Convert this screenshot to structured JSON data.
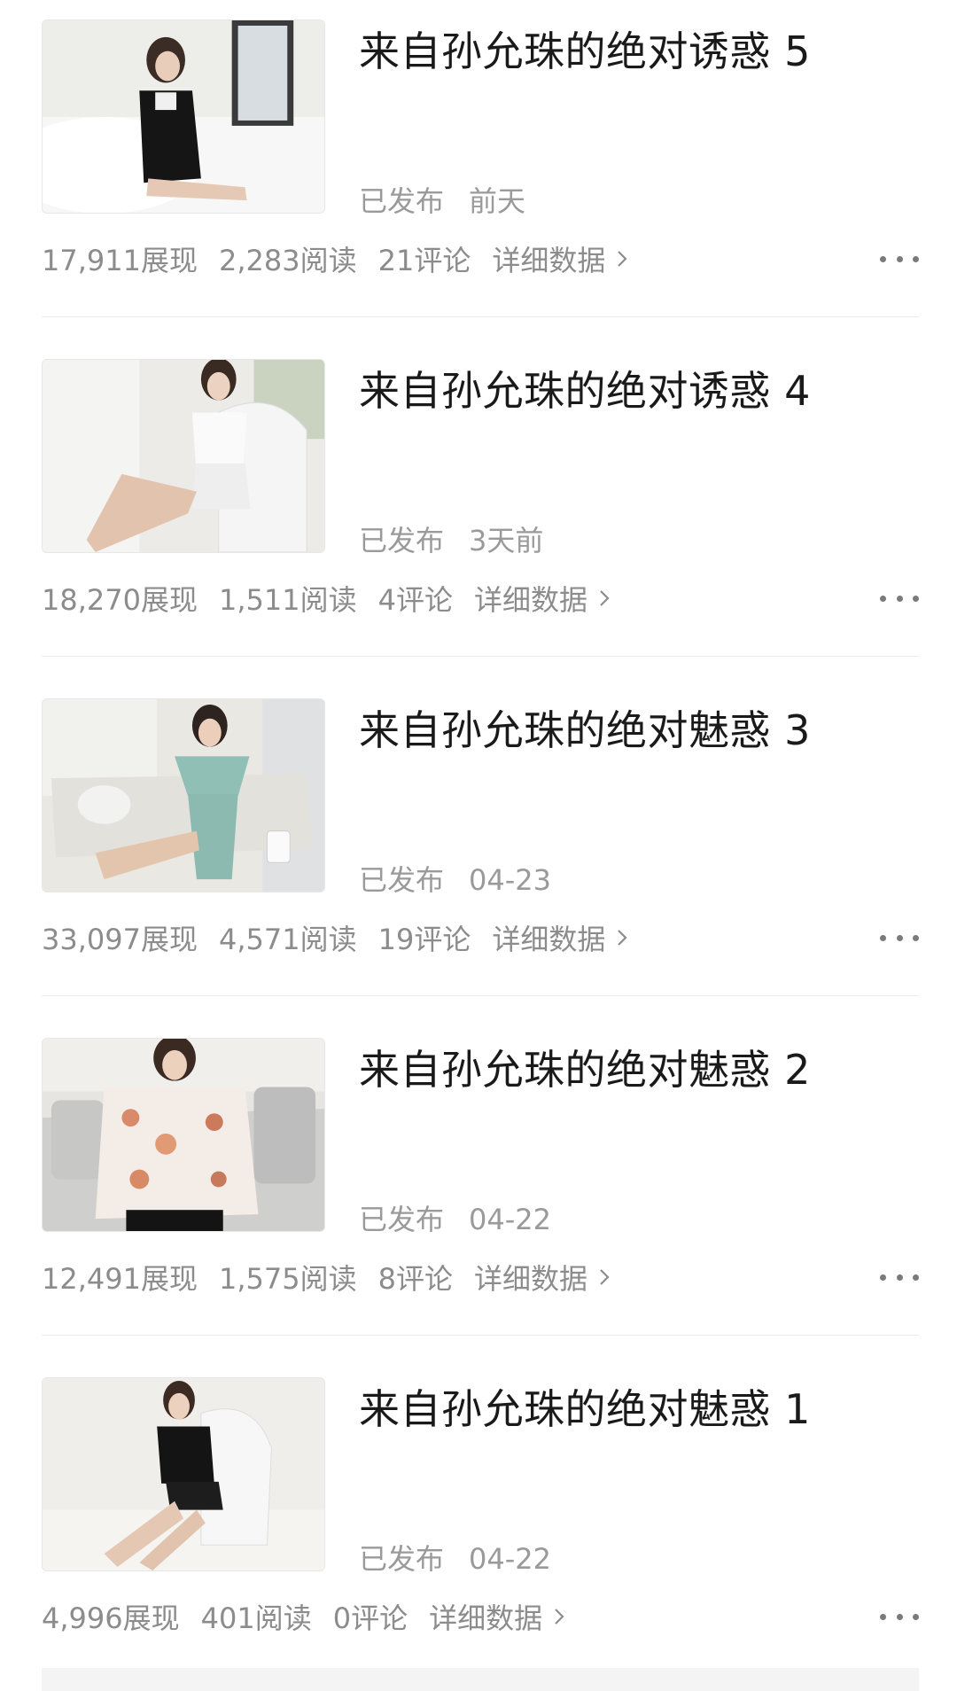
{
  "articles": [
    {
      "title": "来自孙允珠的绝对诱惑 5",
      "status": "已发布",
      "date": "前天",
      "impressions": "17,911展现",
      "reads": "2,283阅读",
      "comments": "21评论",
      "detail": "详细数据"
    },
    {
      "title": "来自孙允珠的绝对诱惑 4",
      "status": "已发布",
      "date": "3天前",
      "impressions": "18,270展现",
      "reads": "1,511阅读",
      "comments": "4评论",
      "detail": "详细数据"
    },
    {
      "title": "来自孙允珠的绝对魅惑 3",
      "status": "已发布",
      "date": "04-23",
      "impressions": "33,097展现",
      "reads": "4,571阅读",
      "comments": "19评论",
      "detail": "详细数据"
    },
    {
      "title": "来自孙允珠的绝对魅惑 2",
      "status": "已发布",
      "date": "04-22",
      "impressions": "12,491展现",
      "reads": "1,575阅读",
      "comments": "8评论",
      "detail": "详细数据"
    },
    {
      "title": "来自孙允珠的绝对魅惑 1",
      "status": "已发布",
      "date": "04-22",
      "impressions": "4,996展现",
      "reads": "401阅读",
      "comments": "0评论",
      "detail": "详细数据"
    }
  ],
  "icons": {
    "detail_arrow": "chevron-right-icon",
    "more": "more-dots-icon"
  },
  "colors": {
    "title": "#1a1a1a",
    "meta": "#9a9a9a",
    "stats": "#8c8c8c",
    "divider": "#ececec"
  }
}
